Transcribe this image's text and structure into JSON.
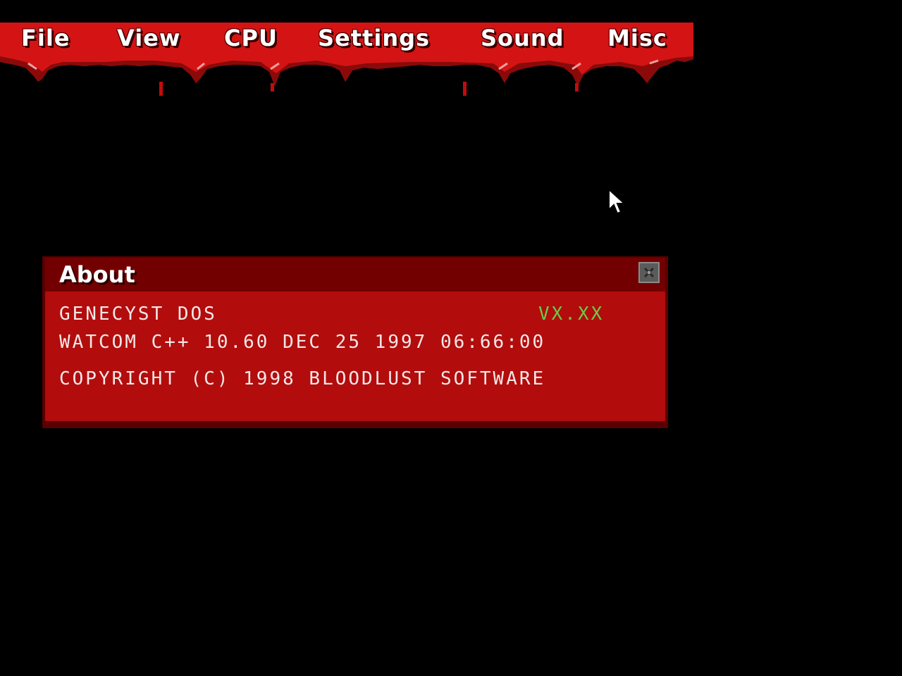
{
  "menu": {
    "items": [
      {
        "label": "File"
      },
      {
        "label": "View"
      },
      {
        "label": "CPU"
      },
      {
        "label": "Settings"
      },
      {
        "label": "Sound"
      },
      {
        "label": "Misc"
      }
    ]
  },
  "about_dialog": {
    "title": "About",
    "app_name": "GENECYST DOS",
    "version": "VX.XX",
    "build_info": "WATCOM C++ 10.60 DEC 25 1997 06:66:00",
    "copyright": "COPYRIGHT (C) 1998 BLOODLUST SOFTWARE"
  },
  "colors": {
    "background": "#000000",
    "menu_red": "#d41414",
    "dialog_body": "#b30c0c",
    "dialog_titlebar": "#720000",
    "version_green": "#6cc84a"
  },
  "icons": {
    "close": "close-icon",
    "cursor": "mouse-pointer-icon"
  }
}
